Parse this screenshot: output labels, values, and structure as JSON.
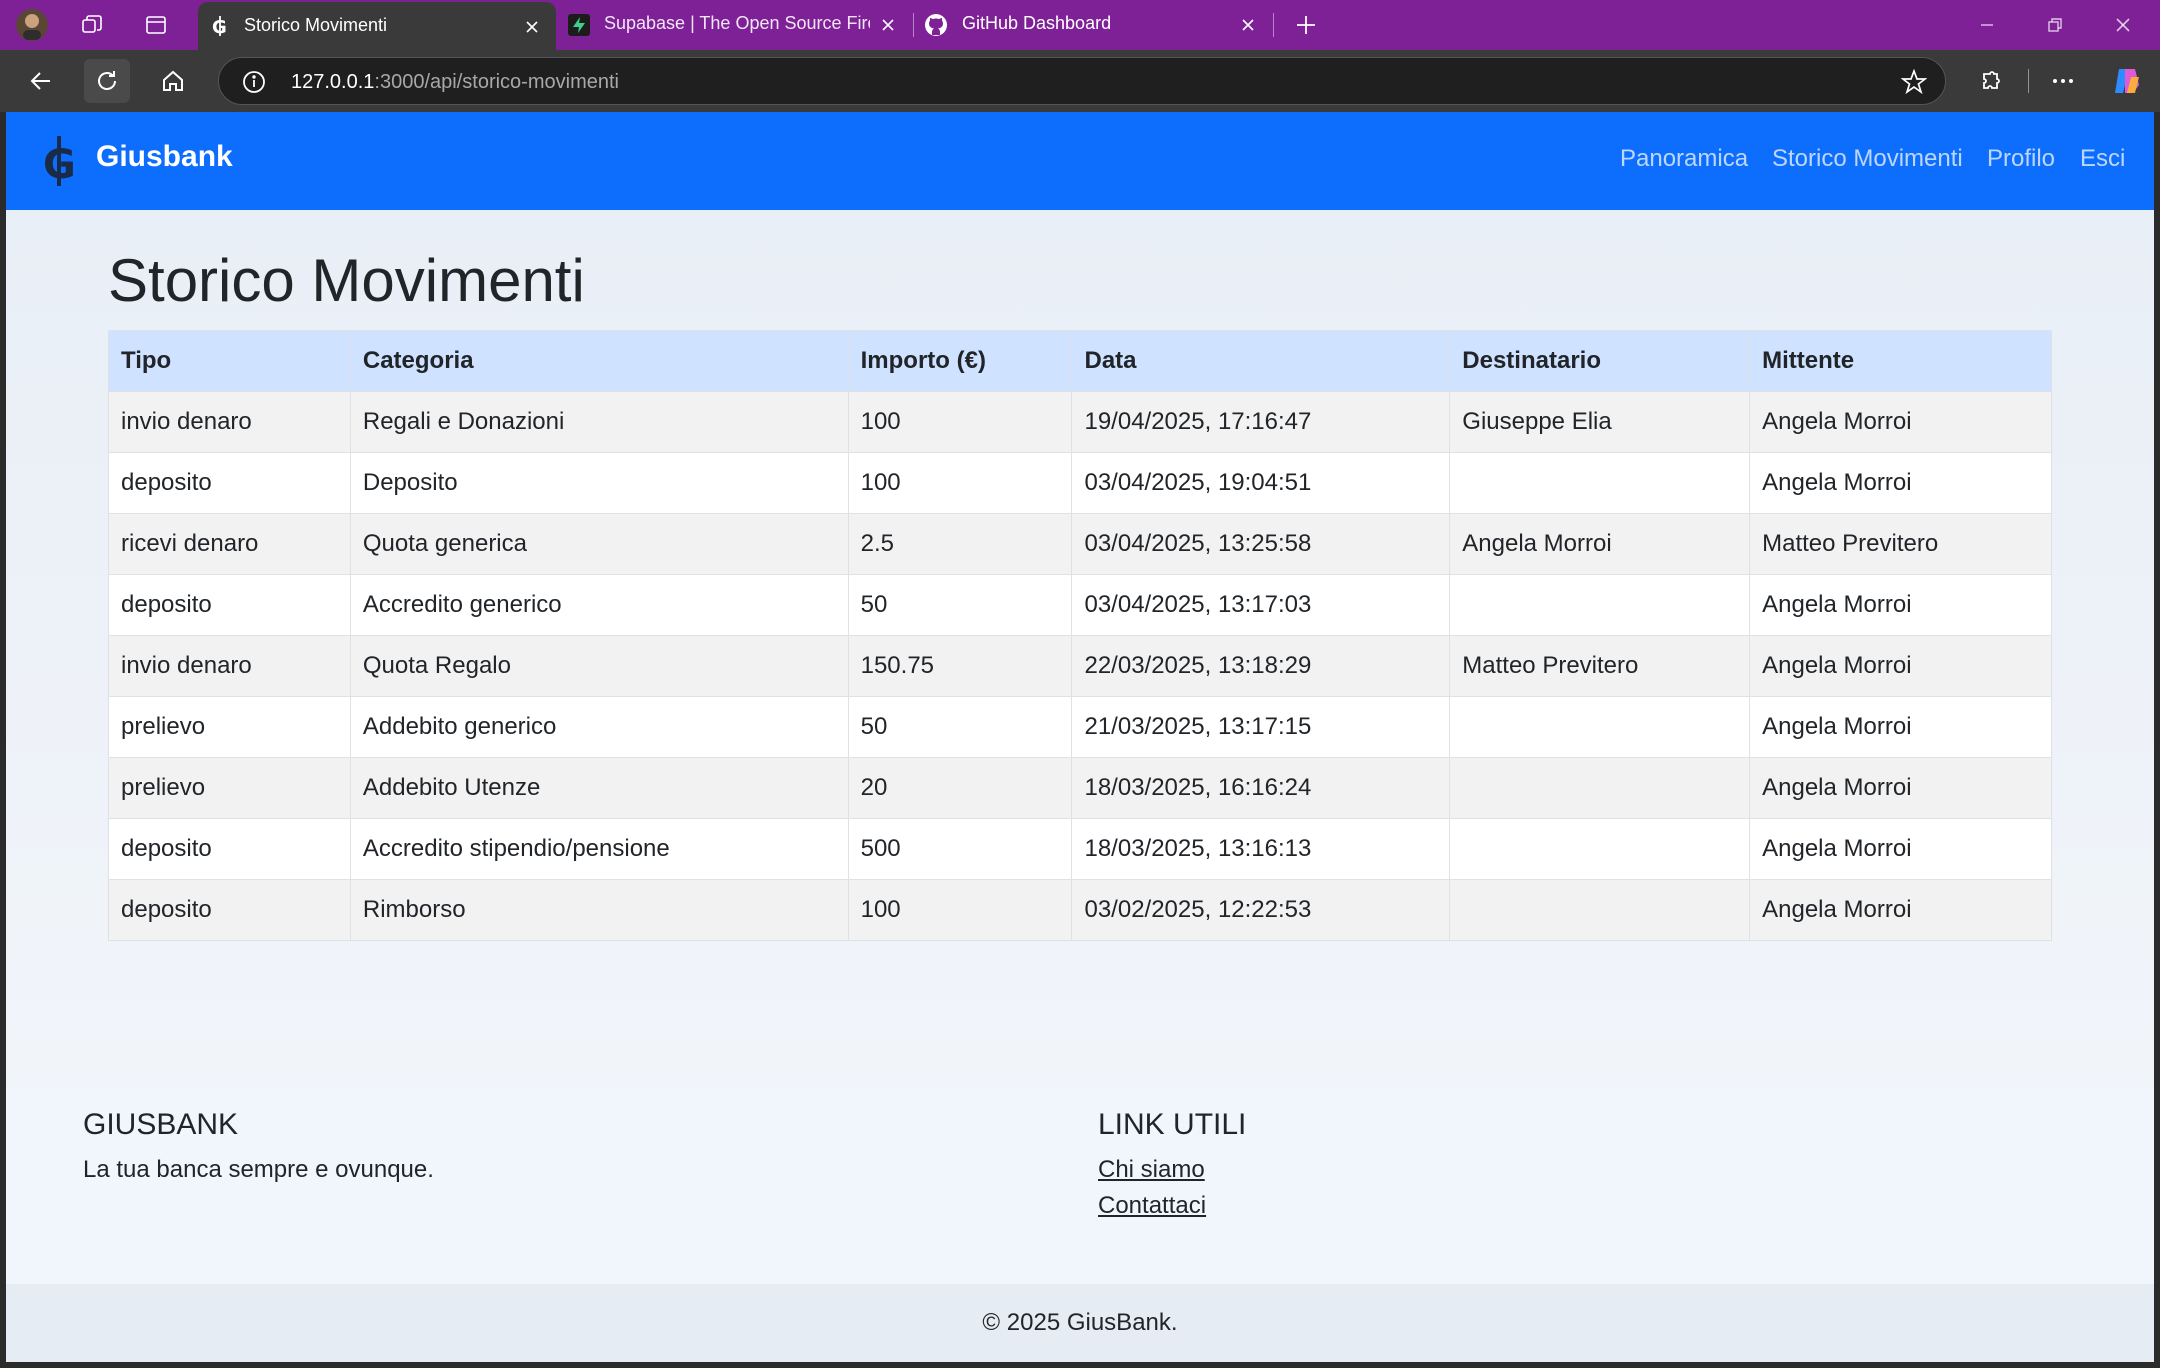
{
  "browser": {
    "tabs": [
      {
        "title": "Storico Movimenti",
        "active": true
      },
      {
        "title": "Supabase | The Open Source Firel",
        "active": false
      },
      {
        "title": "GitHub Dashboard",
        "active": false
      }
    ],
    "url": {
      "host": "127.0.0.1",
      "rest": ":3000/api/storico-movimenti"
    },
    "colors": {
      "tabbar": "#7e2197",
      "toolbar": "#3a3a3a"
    }
  },
  "site": {
    "brand": "Giusbank",
    "nav": [
      "Panoramica",
      "Storico Movimenti",
      "Profilo",
      "Esci"
    ],
    "colors": {
      "navbar": "#0d6efd",
      "table_header": "#cfe2ff"
    }
  },
  "page": {
    "title": "Storico Movimenti",
    "table": {
      "headers": [
        "Tipo",
        "Categoria",
        "Importo (€)",
        "Data",
        "Destinatario",
        "Mittente"
      ],
      "rows": [
        [
          "invio denaro",
          "Regali e Donazioni",
          "100",
          "19/04/2025, 17:16:47",
          "Giuseppe Elia",
          "Angela Morroi"
        ],
        [
          "deposito",
          "Deposito",
          "100",
          "03/04/2025, 19:04:51",
          "",
          "Angela Morroi"
        ],
        [
          "ricevi denaro",
          "Quota generica",
          "2.5",
          "03/04/2025, 13:25:58",
          "Angela Morroi",
          "Matteo Previtero"
        ],
        [
          "deposito",
          "Accredito generico",
          "50",
          "03/04/2025, 13:17:03",
          "",
          "Angela Morroi"
        ],
        [
          "invio denaro",
          "Quota Regalo",
          "150.75",
          "22/03/2025, 13:18:29",
          "Matteo Previtero",
          "Angela Morroi"
        ],
        [
          "prelievo",
          "Addebito generico",
          "50",
          "21/03/2025, 13:17:15",
          "",
          "Angela Morroi"
        ],
        [
          "prelievo",
          "Addebito Utenze",
          "20",
          "18/03/2025, 16:16:24",
          "",
          "Angela Morroi"
        ],
        [
          "deposito",
          "Accredito stipendio/pensione",
          "500",
          "18/03/2025, 13:16:13",
          "",
          "Angela Morroi"
        ],
        [
          "deposito",
          "Rimborso",
          "100",
          "03/02/2025, 12:22:53",
          "",
          "Angela Morroi"
        ]
      ]
    }
  },
  "footer": {
    "brand_heading": "GIUSBANK",
    "tagline": "La tua banca sempre e ovunque.",
    "links_heading": "LINK UTILI",
    "links": [
      "Chi siamo",
      "Contattaci"
    ],
    "copyright": "© 2025 GiusBank."
  }
}
